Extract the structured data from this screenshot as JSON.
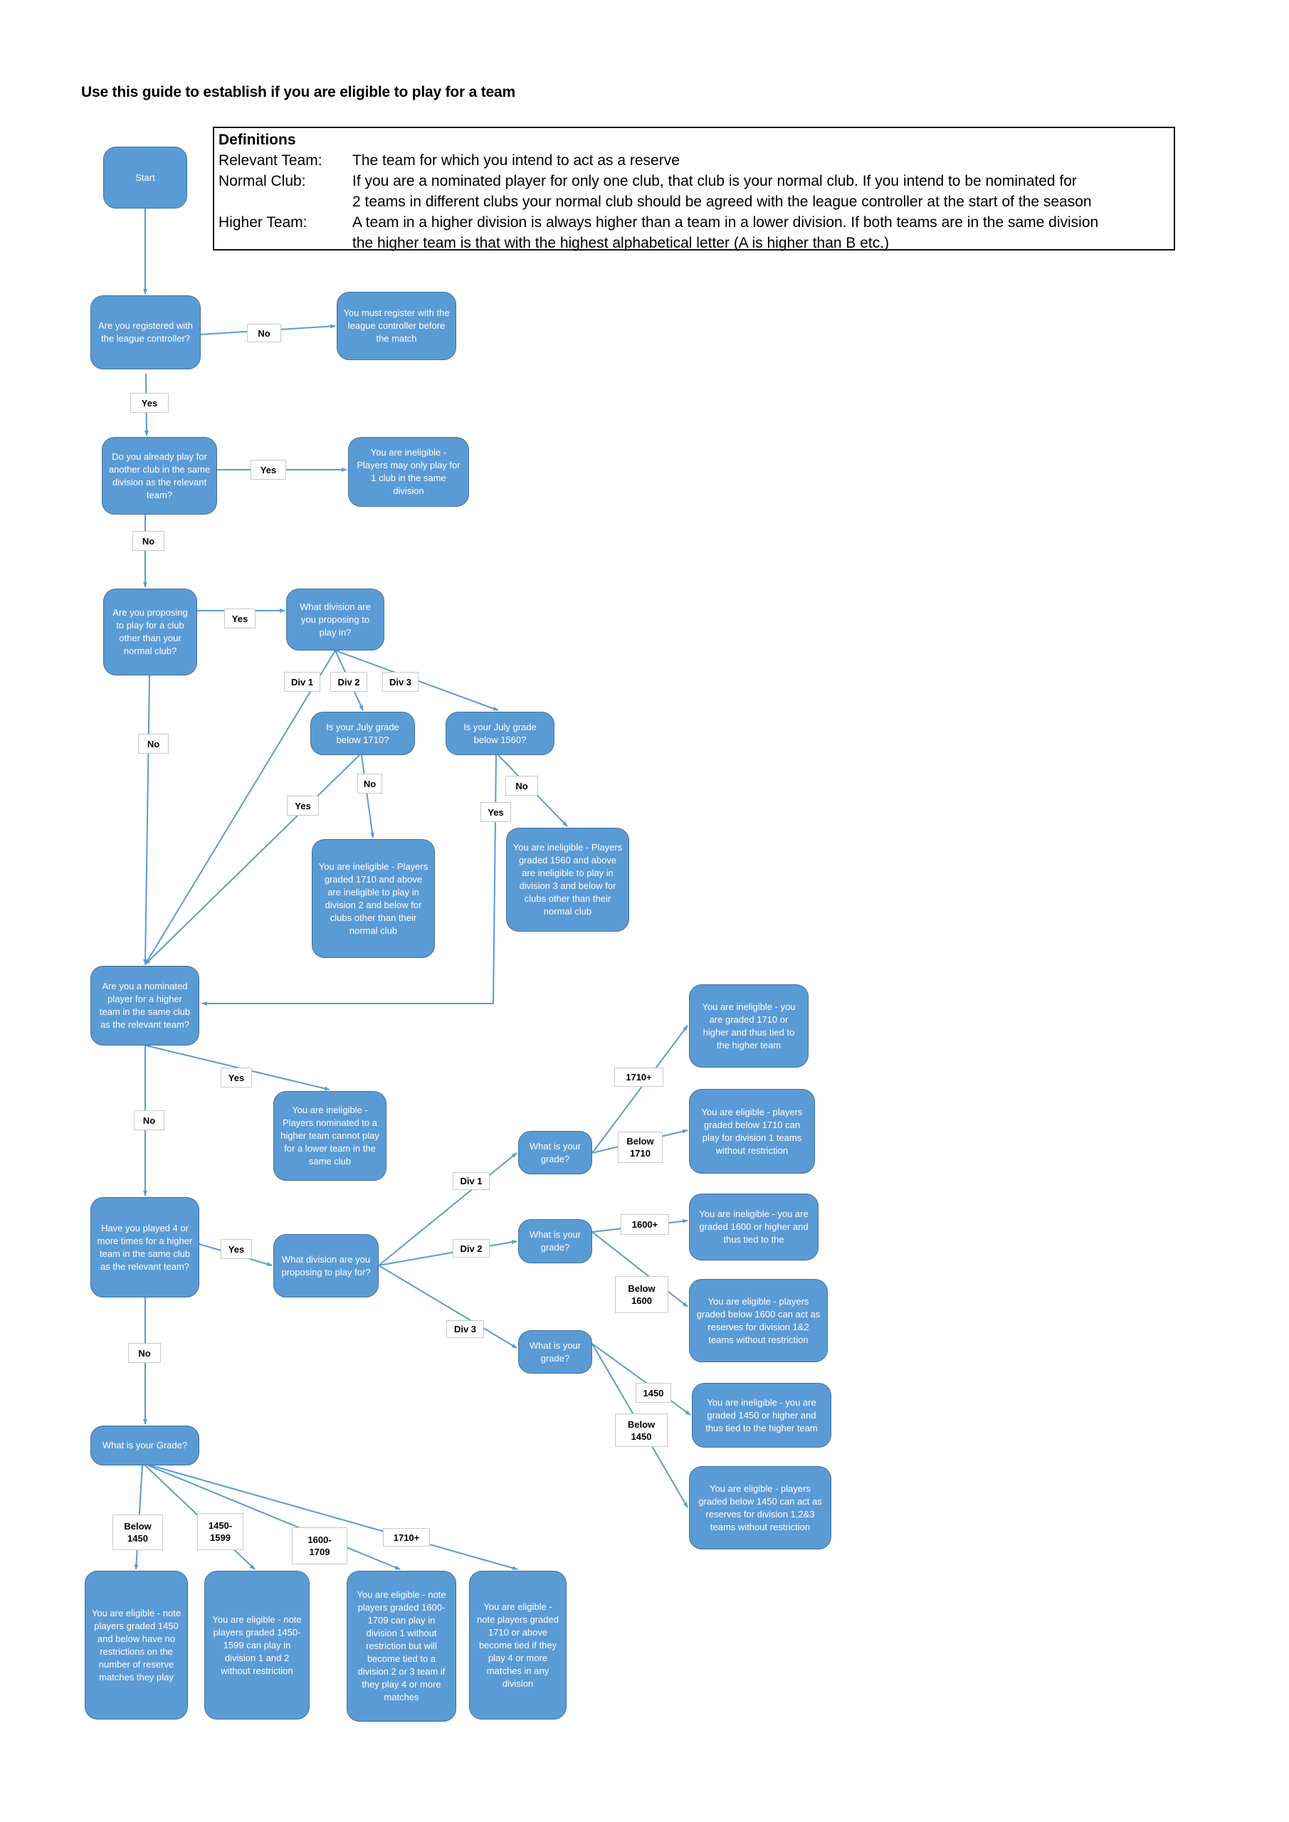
{
  "title": "Use this guide to establish if you are eligible to play for a team",
  "definitions": {
    "heading": "Definitions",
    "items": [
      {
        "term": "Relevant Team:",
        "lines": [
          "The team for which you intend to act as a reserve"
        ]
      },
      {
        "term": "Normal Club:",
        "lines": [
          "If you are a nominated player for only one club, that club is your normal club. If you intend to be nominated for",
          "2 teams in different clubs your normal club should be agreed with the league controller at the start of the season"
        ]
      },
      {
        "term": "Higher Team:",
        "lines": [
          "A team in a higher division is always higher than a team in a lower division. If both teams are in the same division",
          "the higher team is that with the highest alphabetical letter (A is higher than B etc.)"
        ]
      }
    ]
  },
  "nodes": {
    "start": "Start",
    "q_registered": "Are you registered with the league controller?",
    "must_register": "You must register with the league controller before the match",
    "q_already_play": "Do you  already play for another club in the same division as the relevant team?",
    "ineligible_one_club": "You are ineligible - Players may only play for 1 club in the same division",
    "q_other_club": "Are you proposing to play for a club other than your normal club?",
    "q_division_in": "What division are you proposing to play in?",
    "q_july_1710": "Is your July grade below 1710?",
    "q_july_1560": "Is your July grade below 1560?",
    "ineligible_1710_div2": "You are ineligible - Players graded 1710 and above are ineligible to play in division 2 and below for clubs other than their normal club",
    "ineligible_1560_div3": "You are ineligible - Players graded 1560 and above are ineligible to play in division 3 and below for clubs other than their normal club",
    "q_nominated_higher": "Are you a nominated player for a higher team in the same club as the relevant team?",
    "ineligible_nominated": "You are ineligible - Players nominated to a higher team cannot play for a lower team in the same club",
    "q_played_4": "Have you played 4 or more times for a higher team in the same club as the relevant team?",
    "q_division_for": "What division are you proposing to play for?",
    "q_grade_div1": "What is your grade?",
    "q_grade_div2": "What is your grade?",
    "q_grade_div3": "What is your grade?",
    "ineligible_1710_tied": "You are ineligible - you are graded 1710 or higher and thus tied to the higher team",
    "eligible_below_1710": "You are eligible - players graded below 1710 can play for division 1 teams without restriction",
    "ineligible_1600_tied": "You are ineligible - you are graded 1600 or higher and thus tied to the",
    "eligible_below_1600": "You are eligible - players graded below 1600 can act as reserves for division 1&2 teams without restriction",
    "ineligible_1450_tied": "You are ineligible - you are graded 1450 or higher and thus tied to the higher team",
    "eligible_below_1450_div": "You are eligible -  players graded below 1450 can act as reserves for division 1,2&3 teams without restriction",
    "q_your_grade": "What is your Grade?",
    "eligible_below_1450": "You are eligible - note players graded 1450 and below have no restrictions on the number of reserve matches they play",
    "eligible_1450_1599": "You are eligible - note players graded 1450-1599 can play in division 1 and 2 without restriction",
    "eligible_1600_1709": "You are eligible - note players graded 1600-1709 can play in division 1 without restriction but will become tied to a division 2 or 3 team if they play 4 or more matches",
    "eligible_1710_plus": "You are eligible - note players graded 1710 or above become tied if they play 4 or more matches in any division"
  },
  "labels": {
    "no_registered": "No",
    "yes_registered": "Yes",
    "yes_already_play": "Yes",
    "no_already_play": "No",
    "yes_other_club": "Yes",
    "no_other_club": "No",
    "div1_a": "Div 1",
    "div2_a": "Div 2",
    "div3_a": "Div 3",
    "no_1710": "No",
    "yes_1710": "Yes",
    "no_1560": "No",
    "yes_1560": "Yes",
    "yes_nominated": "Yes",
    "no_nominated": "No",
    "yes_played_4": "Yes",
    "no_played_4": "No",
    "div1_b": "Div 1",
    "div2_b": "Div 2",
    "div3_b": "Div 3",
    "g_1710_plus": "1710+",
    "g_below_1710": "Below 1710",
    "g_1600_plus": "1600+",
    "g_below_1600": "Below 1600",
    "g_1450": "1450",
    "g_below_1450_div3": "Below 1450",
    "b_below_1450": "Below 1450",
    "b_1450_1599": "1450- 1599",
    "b_1600_1709": "1600- 1709",
    "b_1710_plus": "1710+"
  },
  "colors": {
    "node_fill": "#5b9bd5",
    "node_border": "#41719c",
    "connector": "#5b9bd5"
  }
}
